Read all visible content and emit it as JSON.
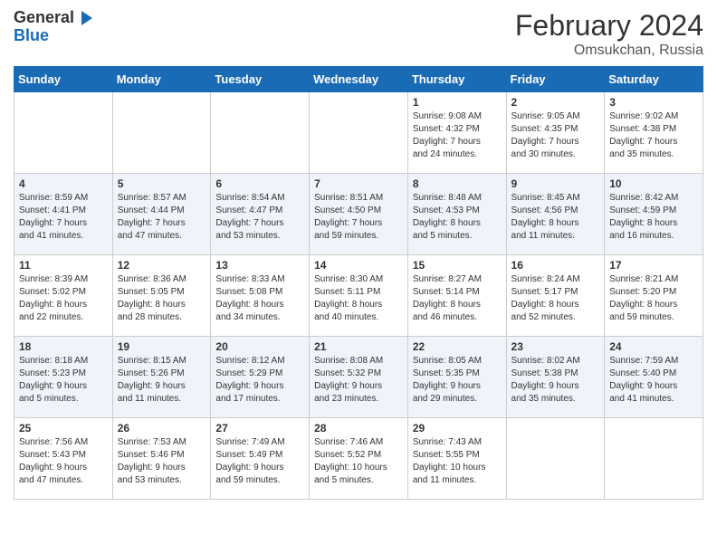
{
  "logo": {
    "line1": "General",
    "line2": "Blue"
  },
  "title": "February 2024",
  "location": "Omsukchan, Russia",
  "weekdays": [
    "Sunday",
    "Monday",
    "Tuesday",
    "Wednesday",
    "Thursday",
    "Friday",
    "Saturday"
  ],
  "weeks": [
    [
      {
        "day": "",
        "info": ""
      },
      {
        "day": "",
        "info": ""
      },
      {
        "day": "",
        "info": ""
      },
      {
        "day": "",
        "info": ""
      },
      {
        "day": "1",
        "info": "Sunrise: 9:08 AM\nSunset: 4:32 PM\nDaylight: 7 hours\nand 24 minutes."
      },
      {
        "day": "2",
        "info": "Sunrise: 9:05 AM\nSunset: 4:35 PM\nDaylight: 7 hours\nand 30 minutes."
      },
      {
        "day": "3",
        "info": "Sunrise: 9:02 AM\nSunset: 4:38 PM\nDaylight: 7 hours\nand 35 minutes."
      }
    ],
    [
      {
        "day": "4",
        "info": "Sunrise: 8:59 AM\nSunset: 4:41 PM\nDaylight: 7 hours\nand 41 minutes."
      },
      {
        "day": "5",
        "info": "Sunrise: 8:57 AM\nSunset: 4:44 PM\nDaylight: 7 hours\nand 47 minutes."
      },
      {
        "day": "6",
        "info": "Sunrise: 8:54 AM\nSunset: 4:47 PM\nDaylight: 7 hours\nand 53 minutes."
      },
      {
        "day": "7",
        "info": "Sunrise: 8:51 AM\nSunset: 4:50 PM\nDaylight: 7 hours\nand 59 minutes."
      },
      {
        "day": "8",
        "info": "Sunrise: 8:48 AM\nSunset: 4:53 PM\nDaylight: 8 hours\nand 5 minutes."
      },
      {
        "day": "9",
        "info": "Sunrise: 8:45 AM\nSunset: 4:56 PM\nDaylight: 8 hours\nand 11 minutes."
      },
      {
        "day": "10",
        "info": "Sunrise: 8:42 AM\nSunset: 4:59 PM\nDaylight: 8 hours\nand 16 minutes."
      }
    ],
    [
      {
        "day": "11",
        "info": "Sunrise: 8:39 AM\nSunset: 5:02 PM\nDaylight: 8 hours\nand 22 minutes."
      },
      {
        "day": "12",
        "info": "Sunrise: 8:36 AM\nSunset: 5:05 PM\nDaylight: 8 hours\nand 28 minutes."
      },
      {
        "day": "13",
        "info": "Sunrise: 8:33 AM\nSunset: 5:08 PM\nDaylight: 8 hours\nand 34 minutes."
      },
      {
        "day": "14",
        "info": "Sunrise: 8:30 AM\nSunset: 5:11 PM\nDaylight: 8 hours\nand 40 minutes."
      },
      {
        "day": "15",
        "info": "Sunrise: 8:27 AM\nSunset: 5:14 PM\nDaylight: 8 hours\nand 46 minutes."
      },
      {
        "day": "16",
        "info": "Sunrise: 8:24 AM\nSunset: 5:17 PM\nDaylight: 8 hours\nand 52 minutes."
      },
      {
        "day": "17",
        "info": "Sunrise: 8:21 AM\nSunset: 5:20 PM\nDaylight: 8 hours\nand 59 minutes."
      }
    ],
    [
      {
        "day": "18",
        "info": "Sunrise: 8:18 AM\nSunset: 5:23 PM\nDaylight: 9 hours\nand 5 minutes."
      },
      {
        "day": "19",
        "info": "Sunrise: 8:15 AM\nSunset: 5:26 PM\nDaylight: 9 hours\nand 11 minutes."
      },
      {
        "day": "20",
        "info": "Sunrise: 8:12 AM\nSunset: 5:29 PM\nDaylight: 9 hours\nand 17 minutes."
      },
      {
        "day": "21",
        "info": "Sunrise: 8:08 AM\nSunset: 5:32 PM\nDaylight: 9 hours\nand 23 minutes."
      },
      {
        "day": "22",
        "info": "Sunrise: 8:05 AM\nSunset: 5:35 PM\nDaylight: 9 hours\nand 29 minutes."
      },
      {
        "day": "23",
        "info": "Sunrise: 8:02 AM\nSunset: 5:38 PM\nDaylight: 9 hours\nand 35 minutes."
      },
      {
        "day": "24",
        "info": "Sunrise: 7:59 AM\nSunset: 5:40 PM\nDaylight: 9 hours\nand 41 minutes."
      }
    ],
    [
      {
        "day": "25",
        "info": "Sunrise: 7:56 AM\nSunset: 5:43 PM\nDaylight: 9 hours\nand 47 minutes."
      },
      {
        "day": "26",
        "info": "Sunrise: 7:53 AM\nSunset: 5:46 PM\nDaylight: 9 hours\nand 53 minutes."
      },
      {
        "day": "27",
        "info": "Sunrise: 7:49 AM\nSunset: 5:49 PM\nDaylight: 9 hours\nand 59 minutes."
      },
      {
        "day": "28",
        "info": "Sunrise: 7:46 AM\nSunset: 5:52 PM\nDaylight: 10 hours\nand 5 minutes."
      },
      {
        "day": "29",
        "info": "Sunrise: 7:43 AM\nSunset: 5:55 PM\nDaylight: 10 hours\nand 11 minutes."
      },
      {
        "day": "",
        "info": ""
      },
      {
        "day": "",
        "info": ""
      }
    ]
  ]
}
